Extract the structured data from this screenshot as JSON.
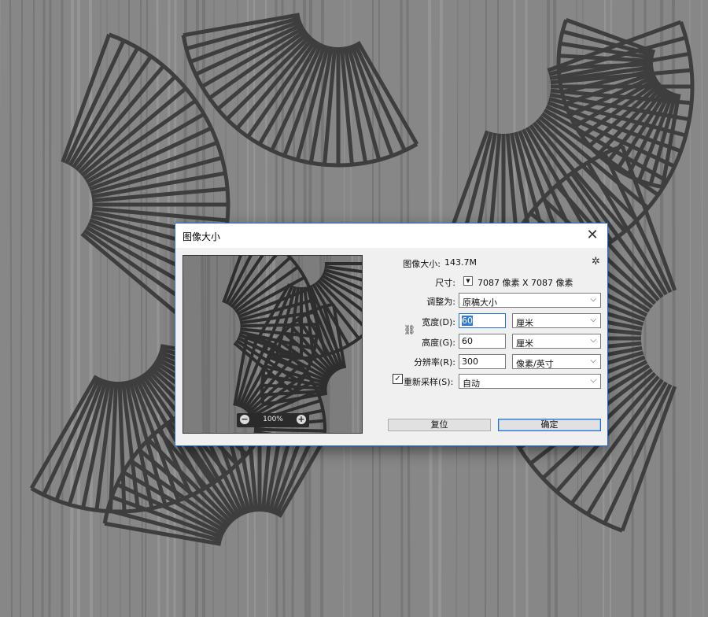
{
  "dialog": {
    "title": "图像大小",
    "close_glyph": "✕",
    "image_size_label": "图像大小:",
    "image_size_value": "143.7M",
    "gear_icon": "gear-icon",
    "dimensions_label": "尺寸:",
    "dimensions_value": "7087 像素  X  7087 像素",
    "fit_to_label": "调整为:",
    "fit_to_value": "原稿大小",
    "width_label": "宽度(D):",
    "width_value": "60",
    "width_unit": "厘米",
    "height_label": "高度(G):",
    "height_value": "60",
    "height_unit": "厘米",
    "resolution_label": "分辨率(R):",
    "resolution_value": "300",
    "resolution_unit": "像素/英寸",
    "resample_label": "重新采样(S):",
    "resample_checked": true,
    "resample_value": "自动",
    "reset_label": "复位",
    "ok_label": "确定",
    "zoom_level": "100%",
    "zoom_out_glyph": "−",
    "zoom_in_glyph": "+",
    "link_icon": "chain-link-icon",
    "accent_color": "#1e6fd0"
  }
}
